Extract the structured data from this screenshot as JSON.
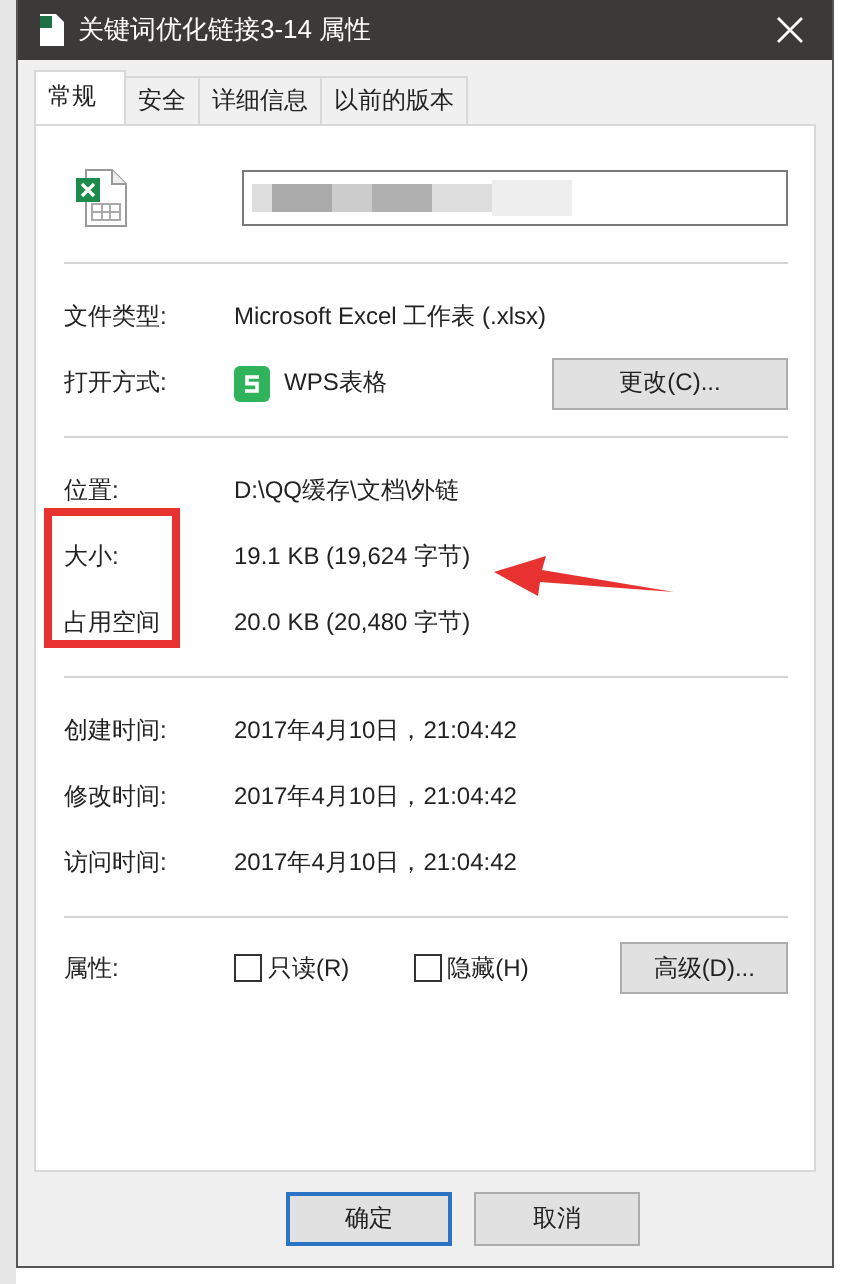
{
  "window": {
    "title": "关键词优化链接3-14 属性"
  },
  "tabs": [
    {
      "label": "常规",
      "selected": true
    },
    {
      "label": "安全",
      "selected": false
    },
    {
      "label": "详细信息",
      "selected": false
    },
    {
      "label": "以前的版本",
      "selected": false
    }
  ],
  "file_name": {
    "kind": "redacted"
  },
  "type_rows": [
    {
      "label": "文件类型:",
      "value": "Microsoft Excel 工作表 (.xlsx)",
      "kind": "text"
    },
    {
      "label": "打开方式:",
      "value": "WPS表格",
      "kind": "app",
      "button": "更改(C)..."
    }
  ],
  "location_rows": [
    {
      "label": "位置:",
      "value": "D:\\QQ缓存\\文档\\外链",
      "highlighted": false
    },
    {
      "label": "大小:",
      "value": "19.1 KB (19,624 字节)",
      "highlighted": true
    },
    {
      "label": "占用空间",
      "value": "20.0 KB (20,480 字节)",
      "highlighted": true
    }
  ],
  "time_rows": [
    {
      "label": "创建时间:",
      "value": "2017年4月10日，21:04:42"
    },
    {
      "label": "修改时间:",
      "value": "2017年4月10日，21:04:42"
    },
    {
      "label": "访问时间:",
      "value": "2017年4月10日，21:04:42"
    }
  ],
  "attributes": {
    "label": "属性:",
    "checkboxes": [
      {
        "label": "只读(R)",
        "checked": false
      },
      {
        "label": "隐藏(H)",
        "checked": false
      }
    ],
    "button": "高级(D)..."
  },
  "buttons": [
    {
      "label": "确定",
      "default": true
    },
    {
      "label": "取消",
      "default": false
    }
  ]
}
